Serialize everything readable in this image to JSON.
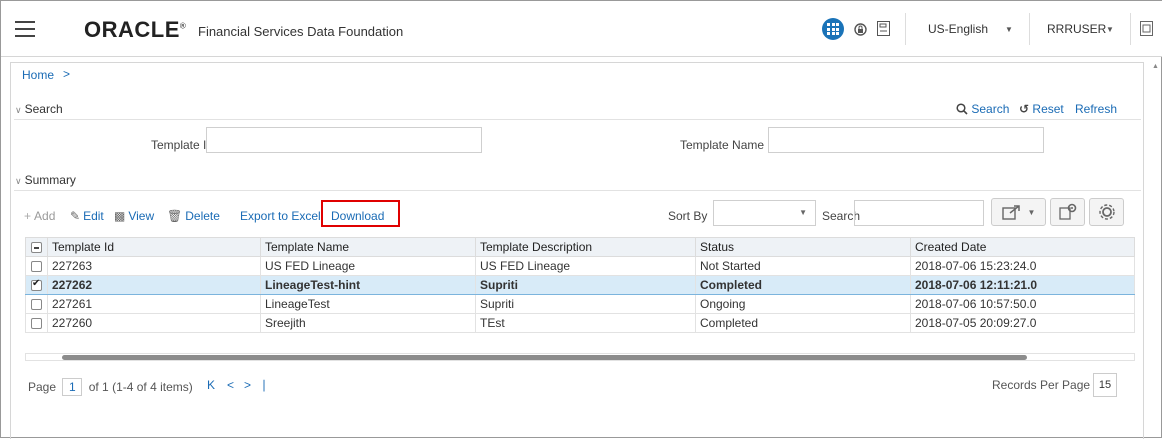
{
  "header": {
    "logo": "ORACLE",
    "logo_mark": "®",
    "product": "Financial Services Data Foundation",
    "language": "US-English",
    "user": "RRRUSER"
  },
  "breadcrumb": {
    "home": "Home",
    "arrow": ">"
  },
  "search": {
    "title": "Search",
    "actions": {
      "search": "Search",
      "reset": "Reset",
      "refresh": "Refresh"
    },
    "fields": {
      "template_id_label": "Template Id",
      "template_id_value": "",
      "template_name_label": "Template Name",
      "template_name_value": ""
    }
  },
  "summary": {
    "title": "Summary",
    "toolbar": {
      "add": "Add",
      "edit": "Edit",
      "view": "View",
      "delete": "Delete",
      "export": "Export to Excel",
      "download": "Download",
      "sort_by": "Sort By",
      "search": "Search"
    },
    "columns": [
      "Template Id",
      "Template Name",
      "Template Description",
      "Status",
      "Created Date"
    ],
    "rows": [
      {
        "id": "227263",
        "name": "US FED Lineage",
        "desc": "US FED Lineage",
        "status": "Not Started",
        "date": "2018-07-06 15:23:24.0",
        "selected": false
      },
      {
        "id": "227262",
        "name": "LineageTest-hint",
        "desc": "Supriti",
        "status": "Completed",
        "date": "2018-07-06 12:11:21.0",
        "selected": true
      },
      {
        "id": "227261",
        "name": "LineageTest",
        "desc": "Supriti",
        "status": "Ongoing",
        "date": "2018-07-06 10:57:50.0",
        "selected": false
      },
      {
        "id": "227260",
        "name": "Sreejith",
        "desc": "TEst",
        "status": "Completed",
        "date": "2018-07-05 20:09:27.0",
        "selected": false
      }
    ]
  },
  "pager": {
    "page_label": "Page",
    "page": "1",
    "info": "of 1 (1-4 of 4 items)",
    "records_label": "Records Per Page",
    "records": "15"
  },
  "colors": {
    "accent": "#1a73b8",
    "link": "#1a6bb5",
    "highlight": "#e00000",
    "selected_row": "#d8ebf8"
  }
}
